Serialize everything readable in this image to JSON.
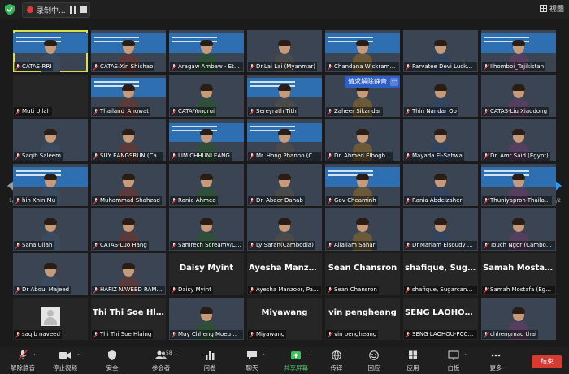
{
  "topbar": {
    "recording_label": "录制中...",
    "view_label": "视图"
  },
  "overlay": {
    "text": "请求解除静音",
    "more": "···"
  },
  "pager": {
    "left": "1/2",
    "right": "1/2"
  },
  "tiles": [
    {
      "label": "CATAS-RRI",
      "kind": "video",
      "bg": "band",
      "active": true
    },
    {
      "label": "CATAS-Xin Shichao",
      "kind": "video",
      "bg": "band"
    },
    {
      "label": "Aragaw Ambaw - Ethio...",
      "kind": "video",
      "bg": "band"
    },
    {
      "label": "Dr.Lai Lai (Myanmar)",
      "kind": "video"
    },
    {
      "label": "Chandana Wickramasi...",
      "kind": "video",
      "bg": "band"
    },
    {
      "label": "Parvatee Devi Luckho -...",
      "kind": "video"
    },
    {
      "label": "Ilhomboi_Tajikistan",
      "kind": "video",
      "bg": "band"
    },
    {
      "label": "Muti Ullah",
      "kind": "blank"
    },
    {
      "label": "Thailand_Anuwat",
      "kind": "video",
      "bg": "band"
    },
    {
      "label": "CATA-Yongrui",
      "kind": "video"
    },
    {
      "label": "Sereyrath Tith",
      "kind": "video",
      "bg": "band"
    },
    {
      "label": "Zaheer Sikandar",
      "kind": "video"
    },
    {
      "label": "Thin Nandar Oo",
      "kind": "video"
    },
    {
      "label": "CATAS-Liu Xiaodong",
      "kind": "video"
    },
    {
      "label": "Saqib Saleem",
      "kind": "video"
    },
    {
      "label": "SUY EANGSRUN (Ca...",
      "kind": "video"
    },
    {
      "label": "LIM CHHUNLEANG",
      "kind": "video",
      "bg": "band"
    },
    {
      "label": "Mr. Hong Phanno (Ca...",
      "kind": "video",
      "bg": "band"
    },
    {
      "label": "Dr. Ahmed Elbogh...",
      "kind": "video"
    },
    {
      "label": "Mayada El-Sabwa",
      "kind": "video"
    },
    {
      "label": "Dr. Amr Said (Egypt)",
      "kind": "video"
    },
    {
      "label": "hin Khin Mu",
      "kind": "video",
      "bg": "band"
    },
    {
      "label": "Muhammad Shahzad",
      "kind": "video"
    },
    {
      "label": "Rania Ahmed",
      "kind": "video"
    },
    {
      "label": "Dr. Abeer Dahab",
      "kind": "video"
    },
    {
      "label": "Gov Cheaminh",
      "kind": "video",
      "bg": "band"
    },
    {
      "label": "Rania Abdelzaher",
      "kind": "video"
    },
    {
      "label": "Thuniyapron-Thaila...",
      "kind": "video",
      "bg": "band"
    },
    {
      "label": "Sana Ullah",
      "kind": "video"
    },
    {
      "label": "CATAS-Luo Hang",
      "kind": "video"
    },
    {
      "label": "Samrech Screamv/Cam...",
      "kind": "video"
    },
    {
      "label": "Ly Saran(Cambodia)",
      "kind": "video"
    },
    {
      "label": "Aliallam Sahar",
      "kind": "video"
    },
    {
      "label": "Dr.Mariam Elsoudy Kh...",
      "kind": "video"
    },
    {
      "label": "Touch Ngor (Cambodia)",
      "kind": "video"
    },
    {
      "label": "Dr Abdul Majeed",
      "kind": "video"
    },
    {
      "label": "HAFIZ NAVEED RAMZ...",
      "kind": "video"
    },
    {
      "label": "Daisy Myint",
      "kind": "name",
      "big": "Daisy Myint"
    },
    {
      "label": "Ayesha Manzoor, Pakis...",
      "kind": "name",
      "big": "Ayesha Manzoo..."
    },
    {
      "label": "Sean Chansron",
      "kind": "name",
      "big": "Sean Chansron"
    },
    {
      "label": "shafique, Sugarcane re...",
      "kind": "name",
      "big": "shafique, Sugar..."
    },
    {
      "label": "Samah Mostafa (Egypt)",
      "kind": "name",
      "big": "Samah Mostafa..."
    },
    {
      "label": "saqib naveed",
      "kind": "avatar"
    },
    {
      "label": "Thi Thi Soe Hlaing",
      "kind": "name",
      "big": "Thi Thi Soe Hlai..."
    },
    {
      "label": "Muy Chheng Moeum (...",
      "kind": "video"
    },
    {
      "label": "Miyawang",
      "kind": "name",
      "big": "Miyawang"
    },
    {
      "label": "vin pengheang",
      "kind": "name",
      "big": "vin pengheang"
    },
    {
      "label": "SENG LAOHOU-PCCFPI",
      "kind": "name",
      "big": "SENG LAOHOU-..."
    },
    {
      "label": "chhengmao thai",
      "kind": "video"
    }
  ],
  "toolbar": {
    "unmute": "解除静音",
    "stop_video": "停止视频",
    "security": "安全",
    "participants": "参会者",
    "participants_count": "58",
    "polls": "问卷",
    "chat": "聊天",
    "share": "共享屏幕",
    "interpret": "传译",
    "reactions": "回应",
    "apps": "应用",
    "whiteboard": "白板",
    "more": "更多",
    "end": "结束"
  },
  "colors": {
    "active_border": "#d7e04a",
    "share_green": "#49c86a",
    "end_red": "#d63b32",
    "overlay_blue": "#2f5fc4"
  }
}
